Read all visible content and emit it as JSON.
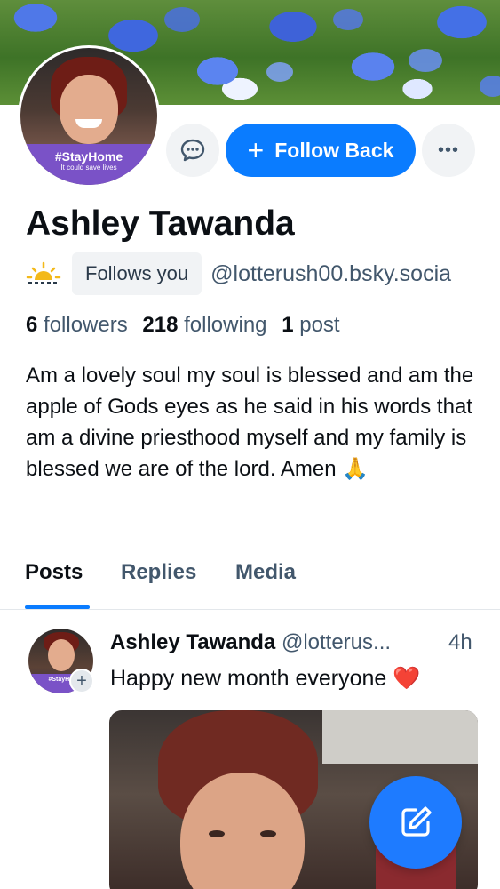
{
  "profile": {
    "avatar_badge_title": "#StayHome",
    "avatar_badge_subtitle": "It could save lives",
    "display_name": "Ashley Tawanda",
    "follows_you": "Follows you",
    "handle": "@lotterush00.bsky.socia",
    "followers_count": "6",
    "followers_label": "followers",
    "following_count": "218",
    "following_label": "following",
    "posts_count": "1",
    "posts_label": "post",
    "bio": "Am a lovely soul my soul is blessed and am the apple of Gods eyes as he said in his words that am a divine priesthood myself and my family is blessed we are of the lord. Amen 🙏"
  },
  "actions": {
    "message_icon": "chat-bubble-icon",
    "follow_plus": "+",
    "follow_back_label": "Follow Back",
    "more_icon": "more-horizontal-icon",
    "more_label": "•••"
  },
  "tabs": [
    {
      "label": "Posts",
      "active": true
    },
    {
      "label": "Replies",
      "active": false
    },
    {
      "label": "Media",
      "active": false
    }
  ],
  "post": {
    "author_name": "Ashley Tawanda",
    "author_handle": "@lotterus...",
    "time": "4h",
    "text": "Happy new month everyone",
    "heart": "❤️",
    "avatar_badge": "#StayHo",
    "plus": "+"
  },
  "fab": {
    "icon": "compose-icon"
  },
  "colors": {
    "accent": "#0a7cff",
    "text_primary": "#0b0f14",
    "text_secondary": "#42576c",
    "badge_bg": "#f1f3f5"
  }
}
